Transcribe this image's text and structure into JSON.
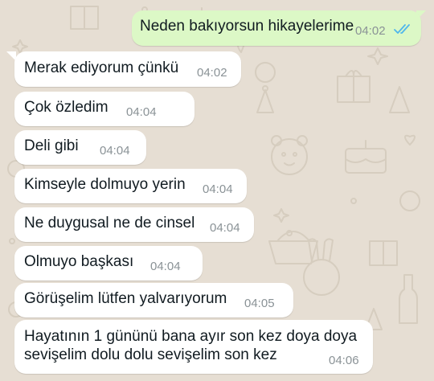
{
  "colors": {
    "background": "#e6ded3",
    "incoming_bubble": "#ffffff",
    "outgoing_bubble": "#dcf8c6",
    "read_ticks": "#4fb6ec",
    "timestamp": "#8a9296"
  },
  "messages": [
    {
      "direction": "outgoing",
      "text": "Neden bakıyorsun hikayelerime",
      "time": "04:02",
      "status_icon": "double-check-read-icon"
    },
    {
      "direction": "incoming",
      "text": "Merak ediyorum çünkü",
      "time": "04:02"
    },
    {
      "direction": "incoming",
      "text": "Çok özledim",
      "time": "04:04"
    },
    {
      "direction": "incoming",
      "text": "Deli gibi",
      "time": "04:04"
    },
    {
      "direction": "incoming",
      "text": "Kimseyle dolmuyo yerin",
      "time": "04:04"
    },
    {
      "direction": "incoming",
      "text": "Ne duygusal ne de cinsel",
      "time": "04:04"
    },
    {
      "direction": "incoming",
      "text": "Olmuyo başkası",
      "time": "04:04"
    },
    {
      "direction": "incoming",
      "text": "Görüşelim lütfen yalvarıyorum",
      "time": "04:05"
    },
    {
      "direction": "incoming",
      "text_lines": [
        "Hayatının 1 gününü bana ayır son kez doya doya",
        "sevişelim dolu dolu sevişelim son kez"
      ],
      "time": "04:06"
    }
  ]
}
